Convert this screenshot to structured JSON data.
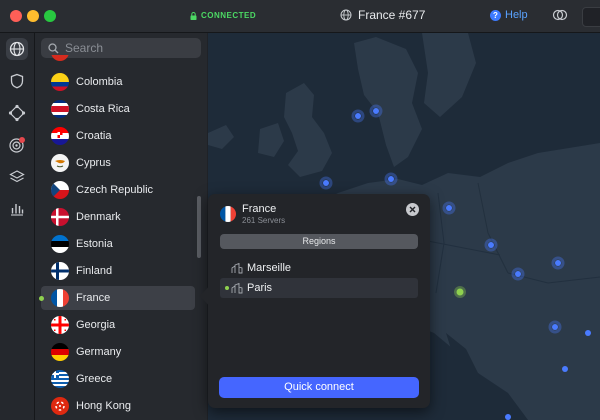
{
  "app": {
    "status": "CONNECTED",
    "server_title": "France #677",
    "help_label": "Help"
  },
  "search": {
    "placeholder": "Search"
  },
  "countries": [
    {
      "name": "Colombia"
    },
    {
      "name": "Costa Rica"
    },
    {
      "name": "Croatia"
    },
    {
      "name": "Cyprus"
    },
    {
      "name": "Czech Republic"
    },
    {
      "name": "Denmark"
    },
    {
      "name": "Estonia"
    },
    {
      "name": "Finland"
    },
    {
      "name": "France",
      "selected": true,
      "connected": true
    },
    {
      "name": "Georgia"
    },
    {
      "name": "Germany"
    },
    {
      "name": "Greece"
    },
    {
      "name": "Hong Kong"
    }
  ],
  "popup": {
    "country": "France",
    "servers": "261 Servers",
    "regions_label": "Regions",
    "regions": [
      {
        "name": "Marseille",
        "active": false
      },
      {
        "name": "Paris",
        "active": true
      }
    ],
    "quick_connect_label": "Quick connect"
  },
  "colors": {
    "accent": "#4566ff",
    "connected": "#4cd964",
    "map_water": "#1e2b39",
    "map_land": "#2c3a49",
    "server_dot": "#4a7bff"
  },
  "icons": {
    "rail": [
      "globe-icon",
      "shield-icon",
      "meshnet-icon",
      "threat-protection-icon",
      "layers-icon",
      "stats-icon"
    ]
  }
}
